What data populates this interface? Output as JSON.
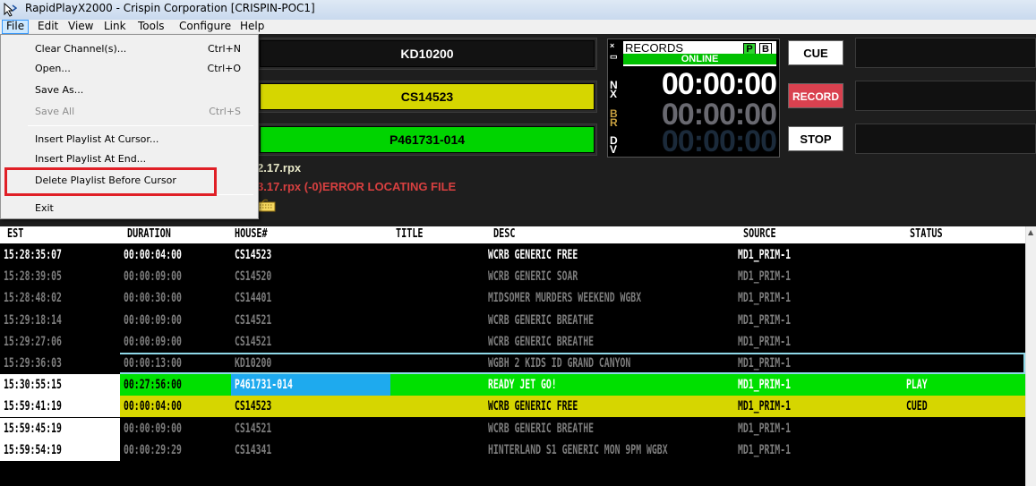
{
  "window": {
    "title": "RapidPlayX2000 - Crispin Corporation [CRISPIN-POC1]"
  },
  "menubar": [
    "File",
    "Edit",
    "View",
    "Link",
    "Tools",
    "Configure",
    "Help"
  ],
  "file_menu": {
    "items": [
      {
        "label": "Clear Channel(s)...",
        "shortcut": "Ctrl+N",
        "disabled": false
      },
      {
        "label": "Open...",
        "shortcut": "Ctrl+O",
        "disabled": false
      },
      {
        "label": "Save As...",
        "shortcut": "",
        "disabled": false
      },
      {
        "label": "Save All",
        "shortcut": "Ctrl+S",
        "disabled": true
      },
      {
        "label": "Insert Playlist At Cursor...",
        "shortcut": "",
        "disabled": false
      },
      {
        "label": "Insert Playlist At End...",
        "shortcut": "",
        "disabled": false
      },
      {
        "label": "Delete Playlist Before Cursor",
        "shortcut": "",
        "disabled": false
      },
      {
        "label": "Exit",
        "shortcut": "",
        "disabled": false
      }
    ]
  },
  "status_bars": {
    "next": "KD10200",
    "cued": "CS14523",
    "playing": "P461731-014"
  },
  "records_panel": {
    "label": "RECORDS",
    "status": "ONLINE",
    "badge_p": "P",
    "badge_b": "B",
    "timer_nx": "00:00:00",
    "timer_br": "00:00:00",
    "timer_dv": "00:00:00",
    "side_nx": "N X",
    "side_br": "B R",
    "side_dv": "D V"
  },
  "controls": {
    "cue": "CUE",
    "record": "RECORD",
    "stop": "STOP"
  },
  "messages": {
    "line1": "2.17.rpx",
    "line2": "3.17.rpx (-0)ERROR LOCATING FILE"
  },
  "grid": {
    "columns": [
      "EST",
      "DURATION",
      "HOUSE#",
      "TITLE",
      "DESC",
      "SOURCE",
      "STATUS"
    ],
    "rows": [
      {
        "est": "15:28:35:07",
        "duration": "00:00:04:00",
        "house": "CS14523",
        "title": "",
        "desc": "WCRB GENERIC FREE",
        "source": "MD1_PRIM-1",
        "status": "",
        "style": "bright"
      },
      {
        "est": "15:28:39:05",
        "duration": "00:00:09:00",
        "house": "CS14520",
        "title": "",
        "desc": "WCRB GENERIC SOAR",
        "source": "MD1_PRIM-1",
        "status": "",
        "style": "dim"
      },
      {
        "est": "15:28:48:02",
        "duration": "00:00:30:00",
        "house": "CS14401",
        "title": "",
        "desc": "MIDSOMER MURDERS WEEKEND WGBX",
        "source": "MD1_PRIM-1",
        "status": "",
        "style": "dim"
      },
      {
        "est": "15:29:18:14",
        "duration": "00:00:09:00",
        "house": "CS14521",
        "title": "",
        "desc": "WCRB GENERIC BREATHE",
        "source": "MD1_PRIM-1",
        "status": "",
        "style": "dim"
      },
      {
        "est": "15:29:27:06",
        "duration": "00:00:09:00",
        "house": "CS14521",
        "title": "",
        "desc": "WCRB GENERIC BREATHE",
        "source": "MD1_PRIM-1",
        "status": "",
        "style": "dim"
      },
      {
        "est": "15:29:36:03",
        "duration": "00:00:13:00",
        "house": "KD10200",
        "title": "",
        "desc": "WGBH 2 KIDS ID GRAND CANYON",
        "source": "MD1_PRIM-1",
        "status": "",
        "style": "selected"
      },
      {
        "est": "15:30:55:15",
        "duration": "00:27:56:00",
        "house": "P461731-014",
        "title": "",
        "desc": "READY JET GO!",
        "source": "MD1_PRIM-1",
        "status": "PLAY",
        "style": "play"
      },
      {
        "est": "15:59:41:19",
        "duration": "00:00:04:00",
        "house": "CS14523",
        "title": "",
        "desc": "WCRB GENERIC FREE",
        "source": "MD1_PRIM-1",
        "status": "CUED",
        "style": "cued"
      },
      {
        "est": "15:59:45:19",
        "duration": "00:00:09:00",
        "house": "CS14521",
        "title": "",
        "desc": "WCRB GENERIC BREATHE",
        "source": "MD1_PRIM-1",
        "status": "",
        "style": "dimwhite"
      },
      {
        "est": "15:59:54:19",
        "duration": "00:00:29:29",
        "house": "CS14341",
        "title": "",
        "desc": "HINTERLAND S1 GENERIC MON 9PM WGBX",
        "source": "MD1_PRIM-1",
        "status": "",
        "style": "dimwhite"
      }
    ]
  },
  "colors": {
    "play_green": "#00e000",
    "cued_yellow": "#d6d600",
    "house_blue": "#1eaaee",
    "record_red": "#d9414f",
    "highlight_red": "#e01f26"
  }
}
